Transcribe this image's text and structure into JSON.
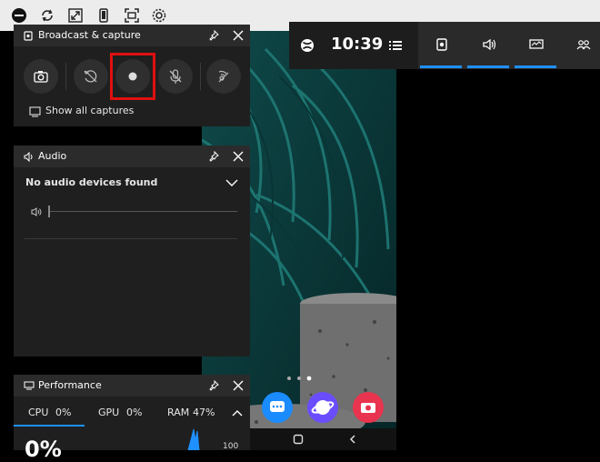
{
  "host_toolbar": {
    "icons": [
      "minus-icon",
      "sync-icon",
      "resize-icon",
      "device-icon",
      "screenshot-icon",
      "settings-icon"
    ]
  },
  "gamebar": {
    "time": "10:39",
    "tabs": [
      "capture-tab",
      "audio-tab",
      "performance-tab",
      "social-tab"
    ]
  },
  "broadcast": {
    "title": "Broadcast & capture",
    "show_all": "Show all captures"
  },
  "audio": {
    "title": "Audio",
    "no_devices": "No audio devices found"
  },
  "performance": {
    "title": "Performance",
    "cpu_label": "CPU",
    "cpu_value": "0%",
    "gpu_label": "GPU",
    "gpu_value": "0%",
    "ram_label": "RAM",
    "ram_value": "47%",
    "big_value": "0%",
    "axis_max": "100"
  },
  "colors": {
    "accent": "#1e90ff",
    "record_highlight": "#e01010"
  }
}
